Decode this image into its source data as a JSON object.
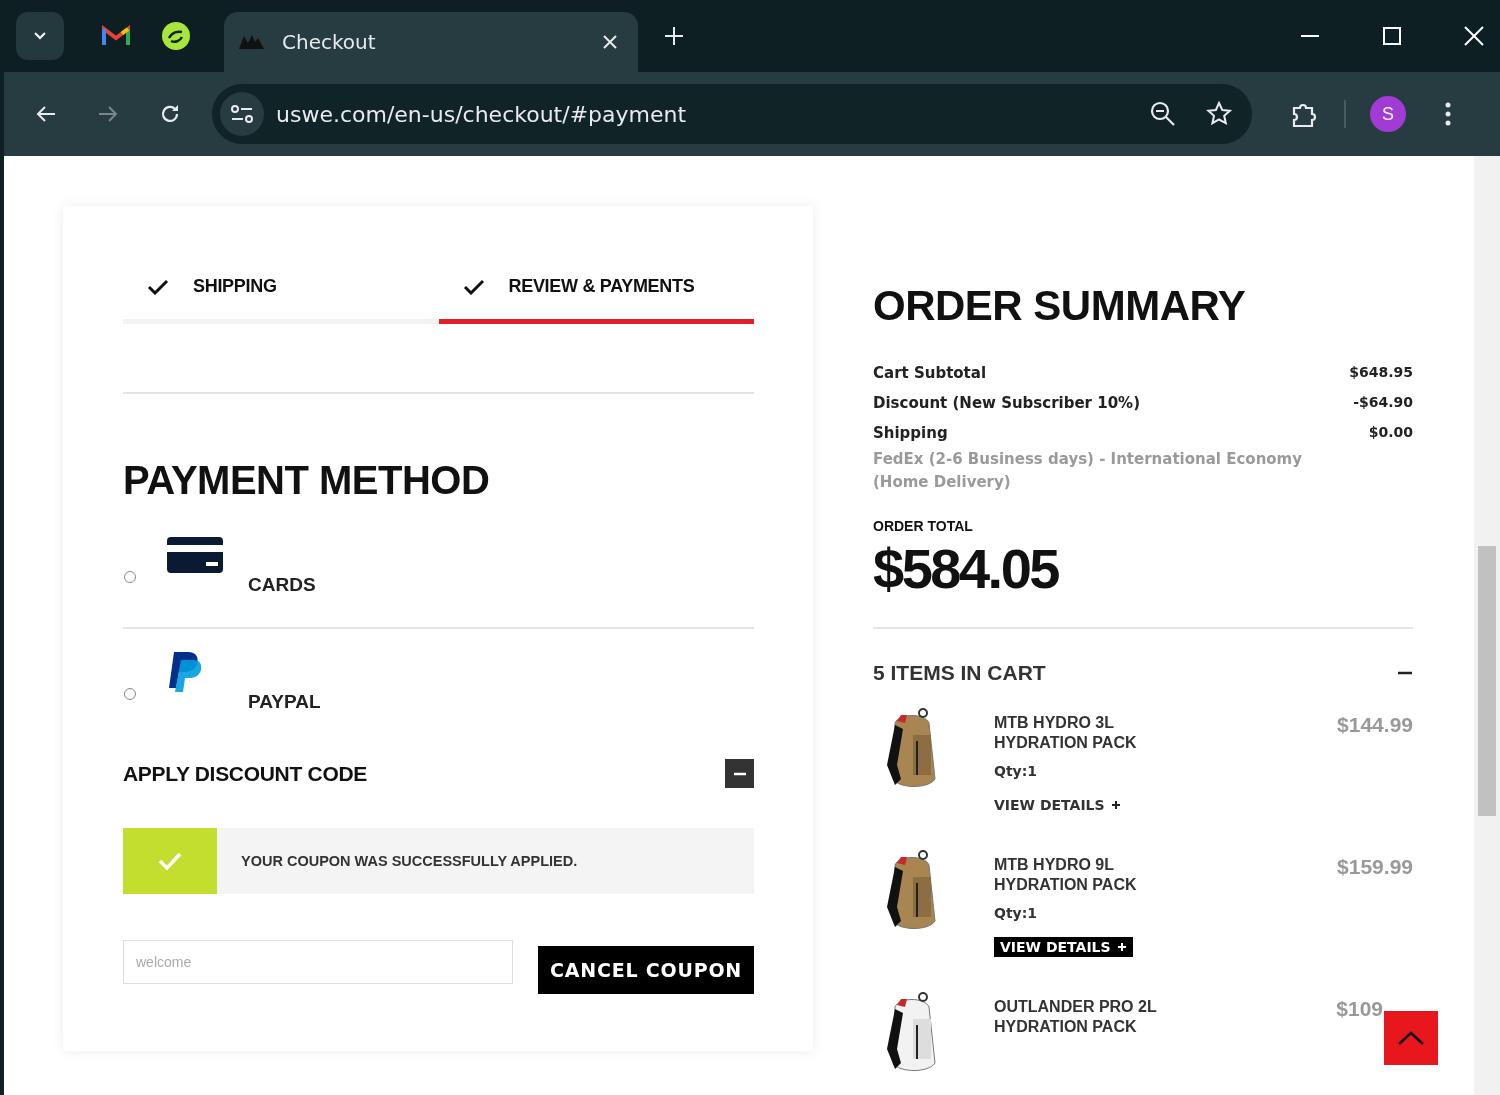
{
  "browser": {
    "tabs": [
      {
        "kind": "mail",
        "selected": false
      },
      {
        "kind": "app",
        "selected": false
      },
      {
        "kind": "page",
        "title": "Checkout",
        "selected": true
      }
    ],
    "url": "uswe.com/en-us/checkout/#payment",
    "profile": "S"
  },
  "steps": [
    {
      "label": "SHIPPING",
      "done": true,
      "selected": false
    },
    {
      "label": "REVIEW & PAYMENTS",
      "done": true,
      "selected": true
    }
  ],
  "payment": {
    "title": "PAYMENT METHOD",
    "methods": [
      {
        "kind": "card",
        "label": "CARDS",
        "selected": false
      },
      {
        "kind": "paypal",
        "label": "PAYPAL",
        "selected": false
      }
    ]
  },
  "discount": {
    "title": "APPLY DISCOUNT CODE",
    "expanded": true,
    "message": "YOUR COUPON WAS SUCCESSFULLY APPLIED.",
    "placeholder": "welcome",
    "button": "CANCEL COUPON"
  },
  "summary": {
    "title": "ORDER SUMMARY",
    "lines": [
      {
        "label": "Cart Subtotal",
        "value": "$648.95"
      },
      {
        "label": "Discount (New Subscriber 10%)",
        "value": "-$64.90"
      },
      {
        "label": "Shipping",
        "value": "$0.00",
        "note": "FedEx (2-6 Business days) - International Economy (Home Delivery)"
      }
    ],
    "total_label": "ORDER TOTAL",
    "total": "$584.05",
    "cart_title": "5 ITEMS IN CART",
    "cart_expanded": true,
    "items": [
      {
        "name": "MTB HYDRO 3L HYDRATION PACK",
        "qty": "Qty:1",
        "details": "VIEW DETAILS",
        "price": "$144.99",
        "selected": false
      },
      {
        "name": "MTB HYDRO 9L HYDRATION PACK",
        "qty": "Qty:1",
        "details": "VIEW DETAILS",
        "price": "$159.99",
        "selected": true
      },
      {
        "name": "OUTLANDER PRO 2L HYDRATION PACK",
        "price": "$109"
      }
    ]
  }
}
